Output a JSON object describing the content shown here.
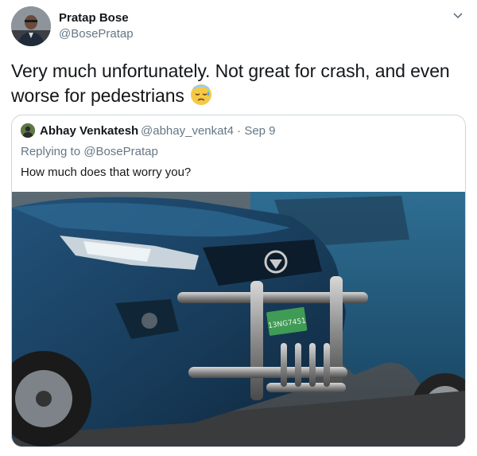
{
  "tweet": {
    "author": {
      "name": "Pratap Bose",
      "handle": "@BosePratap",
      "avatar_icon": "user-avatar"
    },
    "text": "Very much unfortunately. Not great for crash, and even worse for pedestrians",
    "emoji": "downcast-face-with-sweat-emoji",
    "menu_icon": "chevron-down-icon"
  },
  "quoted": {
    "author": {
      "name": "Abhay Venkatesh",
      "handle": "@abhay_venkat4",
      "separator": "·",
      "date": "Sep 9"
    },
    "reply_label": "Replying to",
    "reply_to": "@BosePratap",
    "text": "How much does that worry you?",
    "image": {
      "subject": "blue SUV with front bull bar",
      "plate": "13NG7451"
    }
  },
  "colors": {
    "primary_text": "#14171a",
    "secondary_text": "#657786",
    "border": "#ccd6dd",
    "car_blue": "#1d4a6b",
    "plate_green": "#3f9b55"
  }
}
